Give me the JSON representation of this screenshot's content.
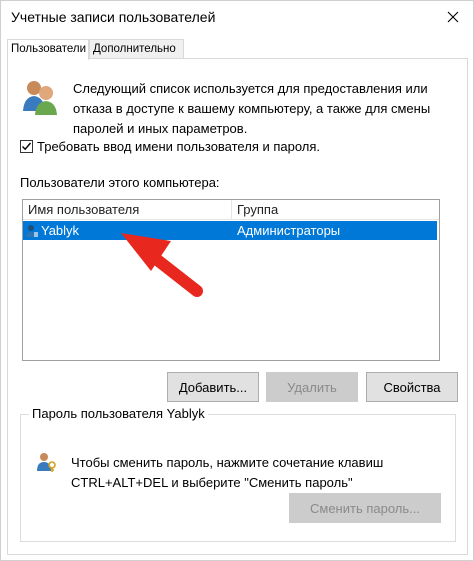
{
  "window": {
    "title": "Учетные записи пользователей"
  },
  "tabs": [
    {
      "label": "Пользователи",
      "active": true
    },
    {
      "label": "Дополнительно",
      "active": false
    }
  ],
  "intro": {
    "text": "Следующий список используется для предоставления или отказа в доступе к вашему компьютеру, а также для смены паролей и иных параметров."
  },
  "require_login": {
    "label": "Требовать ввод имени пользователя и пароля.",
    "checked": true
  },
  "users_section": {
    "label": "Пользователи этого компьютера:",
    "columns": [
      "Имя пользователя",
      "Группа"
    ],
    "rows": [
      {
        "name": "Yablyk",
        "group": "Администраторы",
        "selected": true
      }
    ]
  },
  "buttons": {
    "add": "Добавить...",
    "remove": "Удалить",
    "properties": "Свойства"
  },
  "password_group": {
    "title": "Пароль пользователя Yablyk",
    "text": "Чтобы сменить пароль, нажмите сочетание клавиш CTRL+ALT+DEL и выберите \"Сменить пароль\"",
    "change_button": "Сменить пароль..."
  },
  "colors": {
    "selection": "#0078d7",
    "annotation_arrow": "#e8281e"
  },
  "icons": {
    "close": "close-icon",
    "users": "users-icon",
    "user_row": "user-icon",
    "password": "user-key-icon",
    "annotation": "arrow-annotation"
  }
}
